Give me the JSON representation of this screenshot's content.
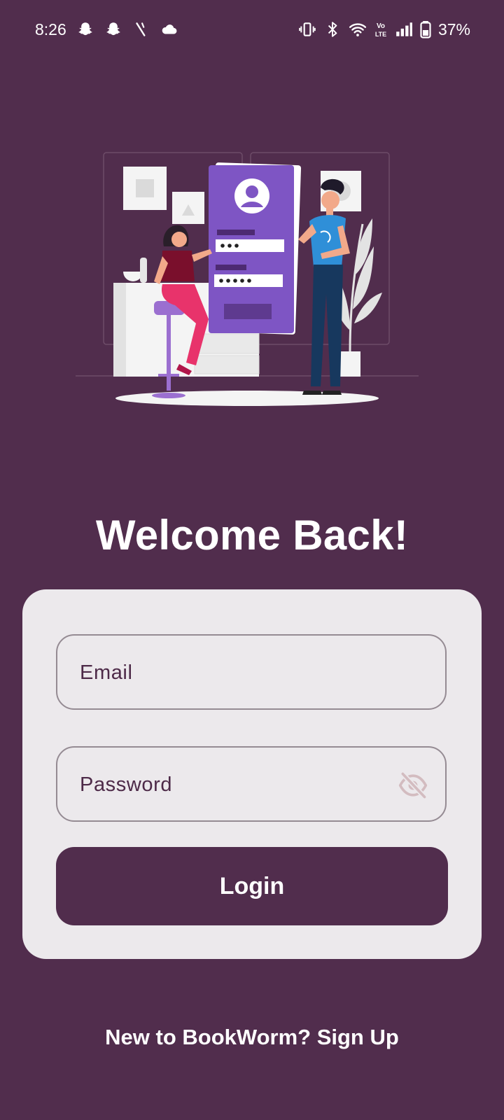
{
  "status_bar": {
    "time": "8:26",
    "battery": "37%",
    "network_badge": "Vo LTE",
    "left_icons": [
      "snapchat-icon",
      "snapchat-icon",
      "pen-icon",
      "cloud-icon"
    ],
    "right_icons": [
      "vibrate-icon",
      "bluetooth-icon",
      "wifi-icon",
      "volte-icon",
      "signal-icon",
      "battery-icon"
    ]
  },
  "illustration": {
    "name": "login-illustration",
    "colors": {
      "background": "#512d4d",
      "phone": "#7e55c4",
      "woman_shirt": "#7a0f2c",
      "woman_pants": "#e8336b",
      "man_shirt": "#2f8fd8",
      "man_pants": "#17385e",
      "furniture": "#f3f3f3"
    }
  },
  "welcome": {
    "title": "Welcome Back!"
  },
  "form": {
    "email": {
      "placeholder": "Email",
      "value": ""
    },
    "password": {
      "placeholder": "Password",
      "value": "",
      "toggle_icon": "eye-off-icon"
    },
    "login_label": "Login"
  },
  "footer": {
    "signup_text": "New to BookWorm? Sign Up"
  },
  "colors": {
    "primary": "#512d4d",
    "card": "#ece9ec",
    "field_border": "#958b93",
    "field_text": "#4d2a48",
    "eye_icon": "#d3bcc0"
  }
}
